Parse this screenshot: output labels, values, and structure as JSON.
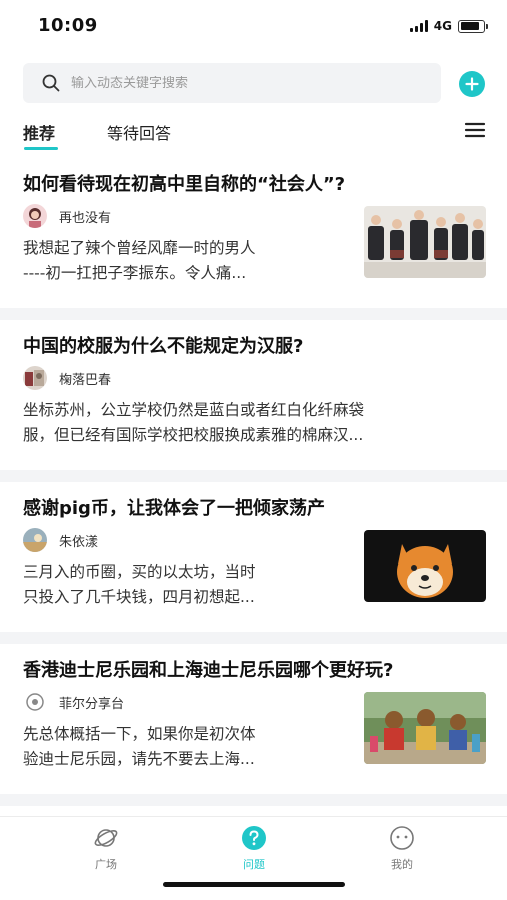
{
  "status_bar": {
    "time": "10:09",
    "network": "4G",
    "battery_level": 0.85
  },
  "search": {
    "placeholder": "输入动态关键字搜索"
  },
  "tabs": [
    {
      "label": "推荐",
      "active": true
    },
    {
      "label": "等待回答",
      "active": false
    }
  ],
  "questions": [
    {
      "title": "如何看待现在初高中里自称的“社会人”?",
      "author": "再也没有",
      "excerpt": "我想起了辣个曾经风靡一时的男人\n----初一扛把子李振东。令人痛..."
    },
    {
      "title": "中国的校服为什么不能规定为汉服?",
      "author": "椈落巴春",
      "excerpt": "坐标苏州，公立学校仍然是蓝白或者红白化纤麻袋\n服，但已经有国际学校把校服换成素雅的棉麻汉..."
    },
    {
      "title": "感谢pig币，让我体会了一把倾家荡产",
      "author": "朱依漾",
      "excerpt": "三月入的币圈，买的以太坊，当时\n只投入了几千块钱，四月初想起..."
    },
    {
      "title": "香港迪士尼乐园和上海迪士尼乐园哪个更好玩?",
      "author": "菲尔分享台",
      "excerpt": "先总体概括一下，如果你是初次体\n验迪士尼乐园，请先不要去上海..."
    }
  ],
  "bottom_nav": [
    {
      "label": "广场",
      "icon": "planet-icon",
      "active": false
    },
    {
      "label": "问题",
      "icon": "question-icon",
      "active": true
    },
    {
      "label": "我的",
      "icon": "face-icon",
      "active": false
    }
  ],
  "colors": {
    "accent": "#1fc6c8",
    "separator": "#f3f4f6",
    "search_bg": "#f2f3f5"
  }
}
